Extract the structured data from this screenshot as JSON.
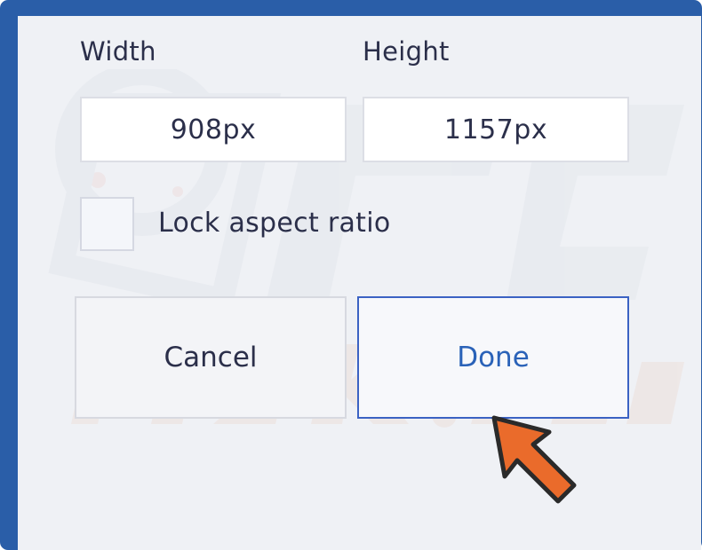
{
  "dialog": {
    "width_label": "Width",
    "height_label": "Height",
    "width_value": "908px",
    "height_value": "1157px",
    "lock_label": "Lock aspect ratio",
    "lock_checked": false,
    "cancel_label": "Cancel",
    "done_label": "Done"
  },
  "colors": {
    "frame": "#2a5ea8",
    "done_border": "#3b62c3",
    "done_text": "#2a62b8",
    "pointer": "#ea6b2b"
  },
  "icons": {
    "pointer": "arrow-pointer-icon"
  }
}
